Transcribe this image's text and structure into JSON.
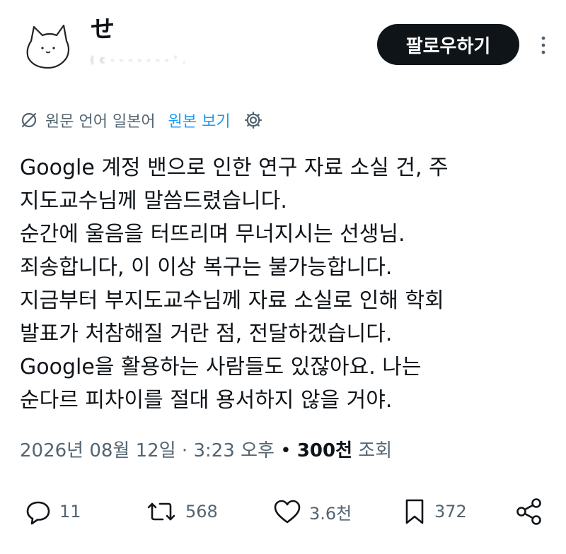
{
  "user": {
    "name": "せ",
    "handle": "( c  -  -  -  -  -  -  - '  ."
  },
  "follow_label": "팔로우하기",
  "translation": {
    "label": "원문 언어 일본어",
    "view_original": "원본 보기"
  },
  "body_lines": [
    "Google 계정 밴으로 인한 연구 자료 소실 건, 주",
    "지도교수님께 말씀드렸습니다.",
    "순간에 울음을 터뜨리며 무너지시는 선생님.",
    "죄송합니다, 이 이상 복구는 불가능합니다.",
    "지금부터 부지도교수님께 자료 소실로 인해 학회",
    "발표가 처참해질 거란 점, 전달하겠습니다.",
    "Google을 활용하는 사람들도 있잖아요. 나는",
    "순다르 피차이를 절대 용서하지 않을 거야."
  ],
  "meta": {
    "date": "2026년 08월 12일",
    "time": "3:23 오후",
    "views_count": "300천",
    "views_label": "조회",
    "separator": "·",
    "bullet": "•"
  },
  "actions": {
    "replies": "11",
    "reposts": "568",
    "likes": "3.6천",
    "bookmarks": "372"
  },
  "icons": [
    "avatar-cat",
    "more-vertical-icon",
    "translate-icon",
    "gear-icon",
    "reply-icon",
    "repost-icon",
    "like-icon",
    "bookmark-icon",
    "share-icon"
  ],
  "colors": {
    "accent": "#1d9bf0",
    "text": "#0f1419",
    "muted": "#536471",
    "button": "#0f1419"
  }
}
